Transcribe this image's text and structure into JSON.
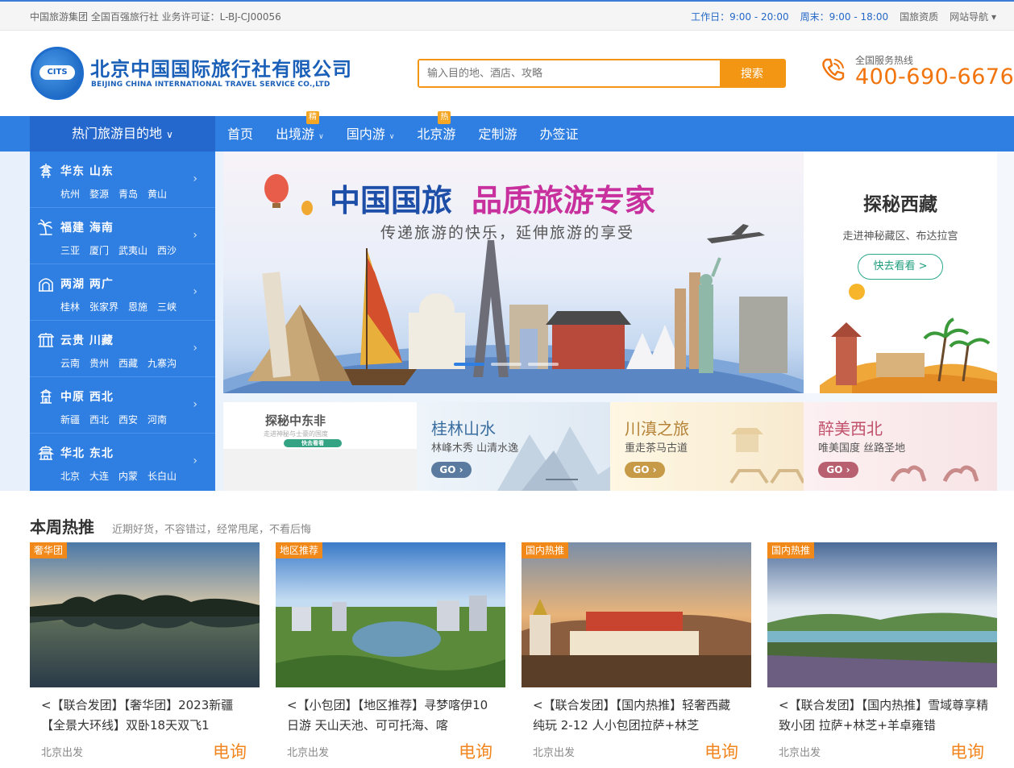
{
  "topbar": {
    "left_text": "中国旅游集团 全国百强旅行社 业务许可证：L-BJ-CJ00056",
    "workday": "工作日：9:00 - 20:00",
    "weekend": "周末：9:00 - 18:00",
    "qualification": "国旅资质",
    "site_nav": "网站导航"
  },
  "logo": {
    "emblem_text": "CITS",
    "name_cn": "北京中国国际旅行社有限公司",
    "name_en": "BEIJING CHINA INTERNATIONAL TRAVEL SERVICE CO.,LTD"
  },
  "search": {
    "placeholder": "输入目的地、酒店、攻略",
    "button": "搜索"
  },
  "hotline": {
    "label": "全国服务热线",
    "number": "400-690-6676"
  },
  "nav": {
    "destinations": "热门旅游目的地",
    "items": [
      {
        "label": "首页",
        "tag": ""
      },
      {
        "label": "出境游",
        "tag": "精"
      },
      {
        "label": "国内游",
        "tag": ""
      },
      {
        "label": "北京游",
        "tag": "热"
      },
      {
        "label": "定制游",
        "tag": ""
      },
      {
        "label": "办签证",
        "tag": ""
      }
    ]
  },
  "sidebar": [
    {
      "title": "华东  山东",
      "subs": [
        "杭州",
        "婺源",
        "青岛",
        "黄山"
      ]
    },
    {
      "title": "福建  海南",
      "subs": [
        "三亚",
        "厦门",
        "武夷山",
        "西沙"
      ]
    },
    {
      "title": "两湖  两广",
      "subs": [
        "桂林",
        "张家界",
        "恩施",
        "三峡"
      ]
    },
    {
      "title": "云贵  川藏",
      "subs": [
        "云南",
        "贵州",
        "西藏",
        "九寨沟"
      ]
    },
    {
      "title": "中原  西北",
      "subs": [
        "新疆",
        "西北",
        "西安",
        "河南"
      ]
    },
    {
      "title": "华北  东北",
      "subs": [
        "北京",
        "大连",
        "内蒙",
        "长白山"
      ]
    }
  ],
  "banner": {
    "headline_a": "中国国旅",
    "headline_b": "品质旅游专家",
    "subline": "传递旅游的快乐，延伸旅游的享受"
  },
  "tibet": {
    "title": "探秘西藏",
    "subtitle": "走进神秘藏区、布达拉宫",
    "button": "快去看看 >"
  },
  "small_banners": [
    {
      "title": "探秘中东非",
      "subtitle": "走进神秘与士豪的国度",
      "go": "快去看看"
    },
    {
      "title": "桂林山水",
      "subtitle": "林峰木秀 山清水逸",
      "go": "GO ›"
    },
    {
      "title": "川滇之旅",
      "subtitle": "重走茶马古道",
      "go": "GO ›"
    },
    {
      "title": "醉美西北",
      "subtitle": "唯美国度 丝路圣地",
      "go": "GO ›"
    }
  ],
  "weekly": {
    "title": "本周热推",
    "subtitle": "近期好货，不容错过，经常甩尾，不看后悔",
    "cards": [
      {
        "badge": "奢华团",
        "title": "<【联合发团】【奢华团】2023新疆【全景大环线】双卧18天双飞1",
        "from": "北京出发",
        "price": "电询"
      },
      {
        "badge": "地区推荐",
        "title": "<【小包团】【地区推荐】寻梦喀伊10日游 天山天池、可可托海、喀",
        "from": "北京出发",
        "price": "电询"
      },
      {
        "badge": "国内热推",
        "title": "<【联合发团】【国内热推】轻奢西藏 纯玩 2-12 人小包团拉萨+林芝",
        "from": "北京出发",
        "price": "电询"
      },
      {
        "badge": "国内热推",
        "title": "<【联合发团】【国内热推】雪域尊享精致小团 拉萨+林芝+羊卓雍错",
        "from": "北京出发",
        "price": "电询"
      }
    ]
  },
  "colors": {
    "brand_blue": "#2f7ee1",
    "accent_orange": "#f29614",
    "price_orange": "#f2851d"
  }
}
